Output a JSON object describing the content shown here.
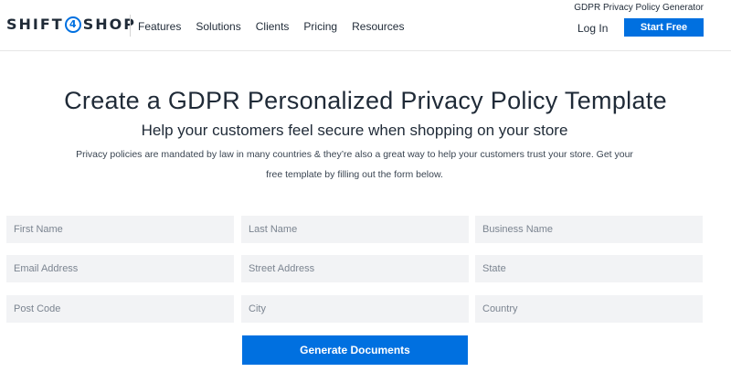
{
  "header": {
    "top_link": "GDPR Privacy Policy Generator",
    "logo": {
      "left": "SHIFT",
      "badge": "4",
      "right": "SHOP"
    },
    "nav": [
      "Features",
      "Solutions",
      "Clients",
      "Pricing",
      "Resources"
    ],
    "login": "Log In",
    "start_free": "Start Free"
  },
  "hero": {
    "title": "Create a GDPR Personalized Privacy Policy Template",
    "subtitle": "Help your customers feel secure when shopping on your store",
    "description": "Privacy policies are mandated by law in many countries & they’re also a great way to help your customers trust your store. Get your free template by filling out the form below."
  },
  "form": {
    "first_name": "First Name",
    "last_name": "Last Name",
    "business_name": "Business Name",
    "email": "Email Address",
    "street": "Street Address",
    "state": "State",
    "post_code": "Post Code",
    "city": "City",
    "country": "Country",
    "submit": "Generate Documents"
  },
  "colors": {
    "brand_blue": "#0070e0",
    "field_bg": "#f2f3f5",
    "text": "#1f2a37"
  }
}
